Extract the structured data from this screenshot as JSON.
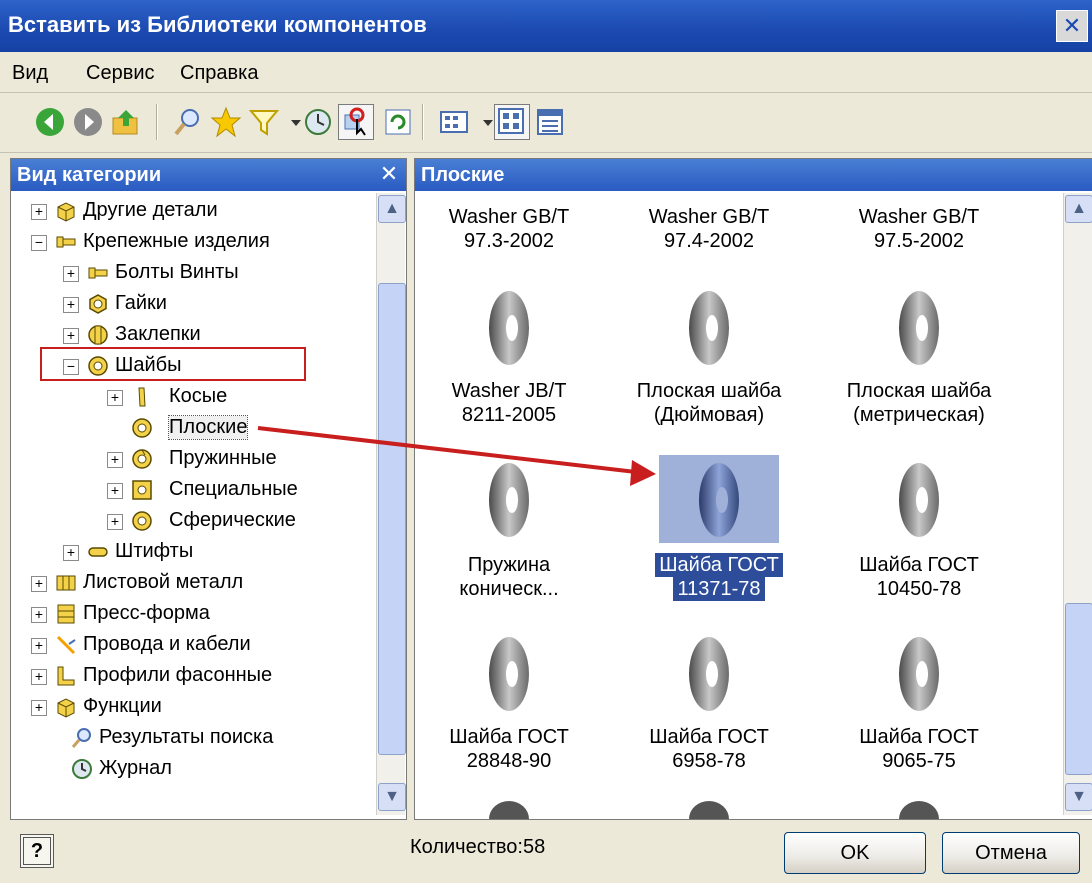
{
  "window": {
    "title": "Вставить из Библиотеки компонентов",
    "close_glyph": "✕"
  },
  "menu": [
    "Вид",
    "Сервис",
    "Справка"
  ],
  "toolbar": {
    "icons": [
      "back-icon",
      "forward-icon",
      "up-folder-icon",
      "search-icon",
      "favorites-star-icon",
      "filter-icon",
      "history-icon",
      "select-component-icon",
      "refresh-icon",
      "view-options-icon",
      "large-icons-view-icon",
      "details-view-icon"
    ]
  },
  "left_panel": {
    "title": "Вид категории",
    "close_glyph": "✕",
    "tree": [
      {
        "label": "Другие детали",
        "expander": "+"
      },
      {
        "label": "Крепежные изделия",
        "expander": "−"
      },
      {
        "label": "Болты  Винты",
        "expander": "+"
      },
      {
        "label": "Гайки",
        "expander": "+"
      },
      {
        "label": "Заклепки",
        "expander": "+"
      },
      {
        "label": "Шайбы",
        "expander": "−"
      },
      {
        "label": "Косые",
        "expander": "+"
      },
      {
        "label": "Плоские",
        "expander": ""
      },
      {
        "label": "Пружинные",
        "expander": "+"
      },
      {
        "label": "Специальные",
        "expander": "+"
      },
      {
        "label": "Сферические",
        "expander": "+"
      },
      {
        "label": "Штифты",
        "expander": "+"
      },
      {
        "label": "Листовой металл",
        "expander": "+"
      },
      {
        "label": "Пресс-форма",
        "expander": "+"
      },
      {
        "label": "Провода и кабели",
        "expander": "+"
      },
      {
        "label": "Профили фасонные",
        "expander": "+"
      },
      {
        "label": "Функции",
        "expander": "+"
      },
      {
        "label": "Результаты поиска",
        "expander": ""
      },
      {
        "label": "Журнал",
        "expander": ""
      }
    ]
  },
  "right_panel": {
    "title": "Плоские",
    "items": [
      {
        "line1": "Washer GB/T",
        "line2": "97.3-2002"
      },
      {
        "line1": "Washer GB/T",
        "line2": "97.4-2002"
      },
      {
        "line1": "Washer GB/T",
        "line2": "97.5-2002"
      },
      {
        "line1": "Washer JB/T",
        "line2": "8211-2005"
      },
      {
        "line1": "Плоская шайба",
        "line2": "(Дюймовая)"
      },
      {
        "line1": "Плоская шайба",
        "line2": "(метрическая)"
      },
      {
        "line1": "Пружина",
        "line2": "коническ..."
      },
      {
        "line1": "Шайба  ГОСТ",
        "line2": "11371-78",
        "selected": true
      },
      {
        "line1": "Шайба ГОСТ",
        "line2": "10450-78"
      },
      {
        "line1": "Шайба ГОСТ",
        "line2": "28848-90"
      },
      {
        "line1": "Шайба ГОСТ",
        "line2": "6958-78"
      },
      {
        "line1": "Шайба ГОСТ",
        "line2": "9065-75"
      }
    ]
  },
  "status": {
    "count": "Количество:58",
    "help_glyph": "?"
  },
  "buttons": {
    "ok": "OK",
    "cancel": "Отмена"
  },
  "colors": {
    "titlebar": "#1b49b0",
    "selection": "#2d4d9a",
    "highlight": "#c81e1e",
    "arrow": "#c81e1e"
  }
}
